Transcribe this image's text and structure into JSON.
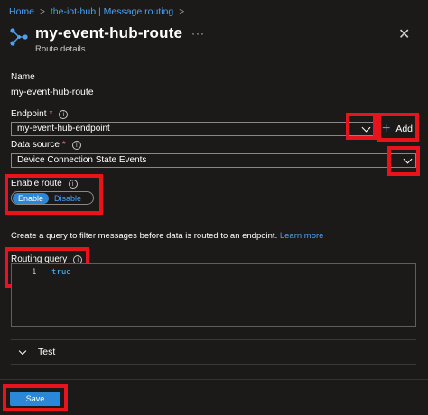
{
  "breadcrumb": {
    "items": [
      "Home",
      "the-iot-hub | Message routing"
    ]
  },
  "header": {
    "title": "my-event-hub-route",
    "subtitle": "Route details",
    "more": "···",
    "close": "✕"
  },
  "name_field": {
    "label": "Name",
    "value": "my-event-hub-route"
  },
  "endpoint": {
    "label": "Endpoint",
    "required": "*",
    "value": "my-event-hub-endpoint",
    "add_label": "Add",
    "add_symbol": "+"
  },
  "data_source": {
    "label": "Data source",
    "required": "*",
    "value": "Device Connection State Events"
  },
  "enable_route": {
    "label": "Enable route",
    "options": [
      "Enable",
      "Disable"
    ],
    "selected": "Enable"
  },
  "description": {
    "text": "Create a query to filter messages before data is routed to an endpoint.",
    "link": "Learn more"
  },
  "routing_query": {
    "label": "Routing query",
    "line_number": "1",
    "code": "true"
  },
  "test_section": {
    "label": "Test"
  },
  "footer": {
    "save_label": "Save"
  },
  "info_glyph": "i",
  "colors": {
    "accent": "#2b88d8",
    "link": "#4ba0f4",
    "highlight_box": "#e8131b",
    "background": "#1b1a19",
    "required": "#f1707b"
  }
}
